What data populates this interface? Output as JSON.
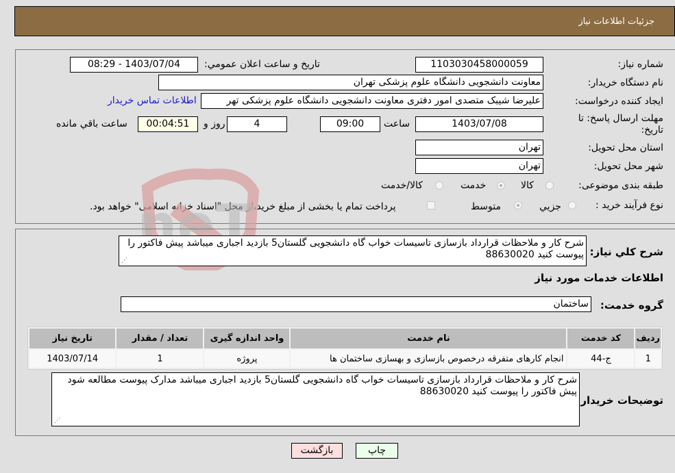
{
  "header": {
    "title": "جزئیات اطلاعات نیاز"
  },
  "fields": {
    "need_number_label": "شماره نیاز:",
    "need_number": "1103030458000059",
    "announce_label": "تاریخ و ساعت اعلان عمومي:",
    "announce_value": "1403/07/04 - 08:29",
    "buyer_org_label": "نام دستگاه خریدار:",
    "buyer_org": "معاونت دانشجویی دانشگاه علوم پزشکی تهران",
    "creator_label": "ایجاد کننده درخواست:",
    "creator": "علیرضا شیبک متصدی امور دفتری معاونت دانشجویی دانشگاه علوم پزشکی تهر",
    "contact_link": "اطلاعات تماس خریدار",
    "deadline_label_1": "مهلت ارسال پاسخ: تا",
    "deadline_label_2": "تاریخ:",
    "deadline_date": "1403/07/08",
    "time_label": "ساعت",
    "deadline_time": "09:00",
    "days": "4",
    "days_label": "روز و",
    "remaining": "00:04:51",
    "remaining_label": "ساعت باقي مانده",
    "province_label": "استان محل تحویل:",
    "province": "تهران",
    "city_label": "شهر محل تحویل:",
    "city": "تهران",
    "category_label": "طبقه بندی موضوعی:",
    "category_options": [
      "کالا",
      "خدمت",
      "کالا/خدمت"
    ],
    "category_selected": "خدمت",
    "process_label": "نوع فرآیند خرید :",
    "process_options": [
      "جزيي",
      "متوسط"
    ],
    "process_selected": "متوسط",
    "payment_note": "پرداخت تمام یا بخشی از مبلغ خرید،از محل \"اسناد خزانه اسلامی\" خواهد بود."
  },
  "description": {
    "label": "شرح كلي نياز:",
    "text": "شرح کار و ملاحظات قرارداد بازسازی تاسیسات خواب گاه دانشجویی گلستان5 بازدید اجباری میباشد پیش فاکتور را پیوست کنید 88630020"
  },
  "services": {
    "section_title": "اطلاعات خدمات مورد نیاز",
    "group_label": "گروه خدمت:",
    "group_value": "ساختمان",
    "columns": [
      "ردیف",
      "کد خدمت",
      "نام خدمت",
      "واحد اندازه گیری",
      "تعداد / مقدار",
      "تاریخ نیاز"
    ],
    "rows": [
      [
        "1",
        "ج-44",
        "انجام کارهای متفرقه درخصوص بازسازی و بهسازی ساختمان ها",
        "پروژه",
        "1",
        "1403/07/14"
      ]
    ]
  },
  "buyer_notes": {
    "label": "توضیحات خریدار:",
    "text": "شرح کار و ملاحظات قرارداد بازسازی تاسیسات خواب گاه دانشجویی گلستان5 بازدید اجباری میباشد مدارک پیوست مطالعه شود پیش فاکتور را پیوست کنید 88630020"
  },
  "buttons": {
    "print": "چاپ",
    "back": "بازگشت"
  },
  "watermark": {
    "text": "AriaTender.neT"
  },
  "colors": {
    "header_bg": "#8c6c42",
    "print_bg": "#eaffea",
    "back_bg": "#ffdede",
    "link": "#1a1ac8",
    "remaining_bg": "#ffffe8"
  }
}
